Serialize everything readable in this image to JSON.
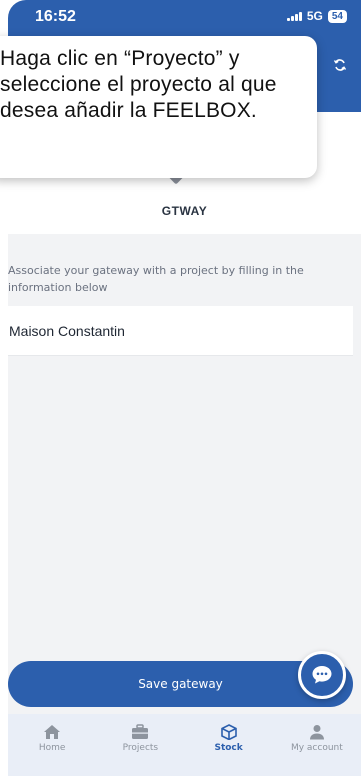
{
  "status": {
    "time": "16:52",
    "network": "5G",
    "battery": "54"
  },
  "tooltip": {
    "text": "Haga clic en “Proyecto” y seleccione el proyecto al que desea añadir la FEELBOX."
  },
  "device": {
    "name": "GTWAY"
  },
  "form": {
    "helper": "Associate your gateway with a project by filling in the information below",
    "project_value": "Maison Constantin"
  },
  "actions": {
    "save_label": "Save gateway"
  },
  "tabs": [
    {
      "label": "Home",
      "icon": "home-icon",
      "active": false
    },
    {
      "label": "Projects",
      "icon": "briefcase-icon",
      "active": false
    },
    {
      "label": "Stock",
      "icon": "box-icon",
      "active": true
    },
    {
      "label": "My account",
      "icon": "user-icon",
      "active": false
    }
  ],
  "colors": {
    "primary": "#2c5fad",
    "background": "#f2f3f5",
    "tabbar": "#e9eef7"
  }
}
